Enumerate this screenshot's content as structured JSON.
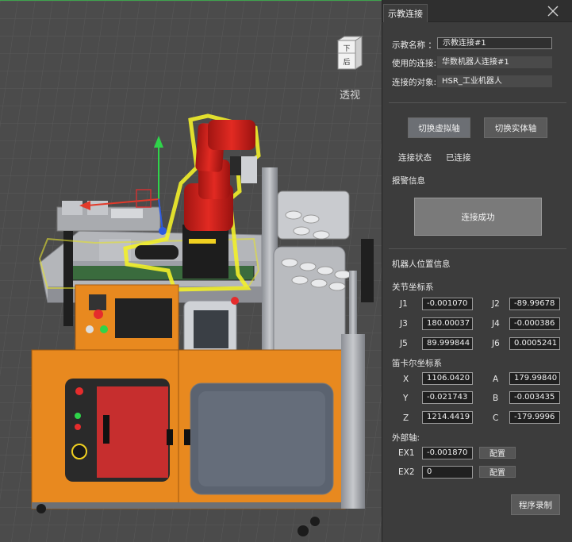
{
  "viewport": {
    "view_cube": {
      "top_face": "下",
      "front_face": "后"
    },
    "view_mode": "透视"
  },
  "panel": {
    "tab": "示教连接",
    "teach_name_label": "示教名称 ：",
    "teach_name_value": "示教连接#1",
    "used_connection_label": "使用的连接:",
    "used_connection_value": "华数机器人连接#1",
    "connected_object_label": "连接的对象:",
    "connected_object_value": "HSR_工业机器人",
    "switch_virtual_label": "切换虚拟轴",
    "switch_real_label": "切换实体轴",
    "connection_status_label": "连接状态",
    "connection_status_value": "已连接",
    "alarm_label": "报警信息",
    "alarm_message": "连接成功",
    "robot_position_label": "机器人位置信息",
    "joint_section_label": "关节坐标系",
    "joints": [
      {
        "name": "J1",
        "value": "-0.001070"
      },
      {
        "name": "J2",
        "value": "-89.99678"
      },
      {
        "name": "J3",
        "value": "180.00037"
      },
      {
        "name": "J4",
        "value": "-0.000386"
      },
      {
        "name": "J5",
        "value": "89.999844"
      },
      {
        "name": "J6",
        "value": "0.0005241"
      }
    ],
    "cartesian_section_label": "笛卡尔坐标系",
    "cartesian": [
      {
        "name": "X",
        "value": "1106.0420"
      },
      {
        "name": "A",
        "value": "179.99840"
      },
      {
        "name": "Y",
        "value": "-0.021743"
      },
      {
        "name": "B",
        "value": "-0.003435"
      },
      {
        "name": "Z",
        "value": "1214.4419"
      },
      {
        "name": "C",
        "value": "-179.9996"
      }
    ],
    "external_axis_label": "外部轴:",
    "external": [
      {
        "name": "EX1",
        "value": "-0.001870",
        "config_label": "配置"
      },
      {
        "name": "EX2",
        "value": "0",
        "config_label": "配置"
      }
    ],
    "record_program_label": "程序录制"
  },
  "colors": {
    "robot_red": "#d8211d",
    "highlight_yellow": "#f2ef2a",
    "cabinet_orange": "#e8891f",
    "grid_bg": "#4a4a4a",
    "panel_bg": "#3c3c3c"
  }
}
